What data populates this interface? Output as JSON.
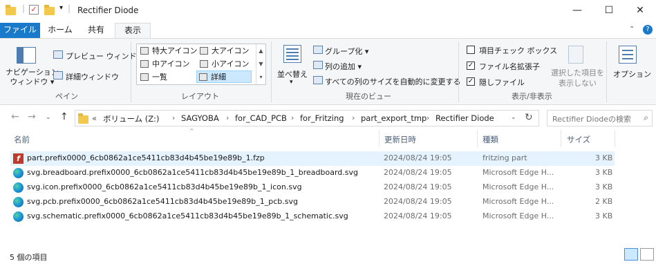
{
  "window": {
    "title": "Rectifier Diode",
    "minimize": "—",
    "maximize": "☐",
    "close": "✕"
  },
  "ribbon_tabs": [
    {
      "label": "ファイル"
    },
    {
      "label": "ホーム"
    },
    {
      "label": "共有"
    },
    {
      "label": "表示"
    }
  ],
  "ribbon": {
    "pane": {
      "nav_pane": "ナビゲーション\nウィンドウ ▾",
      "preview": "プレビュー ウィンドウ",
      "details": "詳細ウィンドウ",
      "group": "ペイン"
    },
    "layout": {
      "items": [
        "特大アイコン",
        "大アイコン",
        "中アイコン",
        "小アイコン",
        "一覧",
        "詳細"
      ],
      "group": "レイアウト"
    },
    "current_view": {
      "sort": "並べ替え",
      "group_by": "グループ化 ▾",
      "add_column": "列の追加 ▾",
      "fit_columns": "すべての列のサイズを自動的に変更する",
      "group": "現在のビュー"
    },
    "show_hide": {
      "item_checkboxes": "項目チェック ボックス",
      "extensions": "ファイル名拡張子",
      "hidden": "隠しファイル",
      "hide_selected": "選択した項目を\n表示しない",
      "group": "表示/非表示"
    },
    "options": "オプション"
  },
  "address": {
    "crumbs": [
      "«",
      "ボリューム (Z:)",
      "SAGYOBA",
      "for_CAD_PCB",
      "for_Fritzing",
      "part_export_tmp",
      "Rectifier Diode"
    ],
    "search_placeholder": "Rectifier Diodeの検索"
  },
  "columns": [
    "名前",
    "更新日時",
    "種類",
    "サイズ"
  ],
  "files": [
    {
      "name": "part.prefix0000_6cb0862a1ce5411cb83d4b45be19e89b_1.fzp",
      "date": "2024/08/24 19:05",
      "type": "fritzing part",
      "size": "3 KB",
      "icon": "fritzing-icon"
    },
    {
      "name": "svg.breadboard.prefix0000_6cb0862a1ce5411cb83d4b45be19e89b_1_breadboard.svg",
      "date": "2024/08/24 19:05",
      "type": "Microsoft Edge H...",
      "size": "3 KB",
      "icon": "edge-icon"
    },
    {
      "name": "svg.icon.prefix0000_6cb0862a1ce5411cb83d4b45be19e89b_1_icon.svg",
      "date": "2024/08/24 19:05",
      "type": "Microsoft Edge H...",
      "size": "3 KB",
      "icon": "edge-icon"
    },
    {
      "name": "svg.pcb.prefix0000_6cb0862a1ce5411cb83d4b45be19e89b_1_pcb.svg",
      "date": "2024/08/24 19:05",
      "type": "Microsoft Edge H...",
      "size": "2 KB",
      "icon": "edge-icon"
    },
    {
      "name": "svg.schematic.prefix0000_6cb0862a1ce5411cb83d4b45be19e89b_1_schematic.svg",
      "date": "2024/08/24 19:05",
      "type": "Microsoft Edge H...",
      "size": "3 KB",
      "icon": "edge-icon"
    }
  ],
  "status": {
    "count": "5 個の項目"
  }
}
